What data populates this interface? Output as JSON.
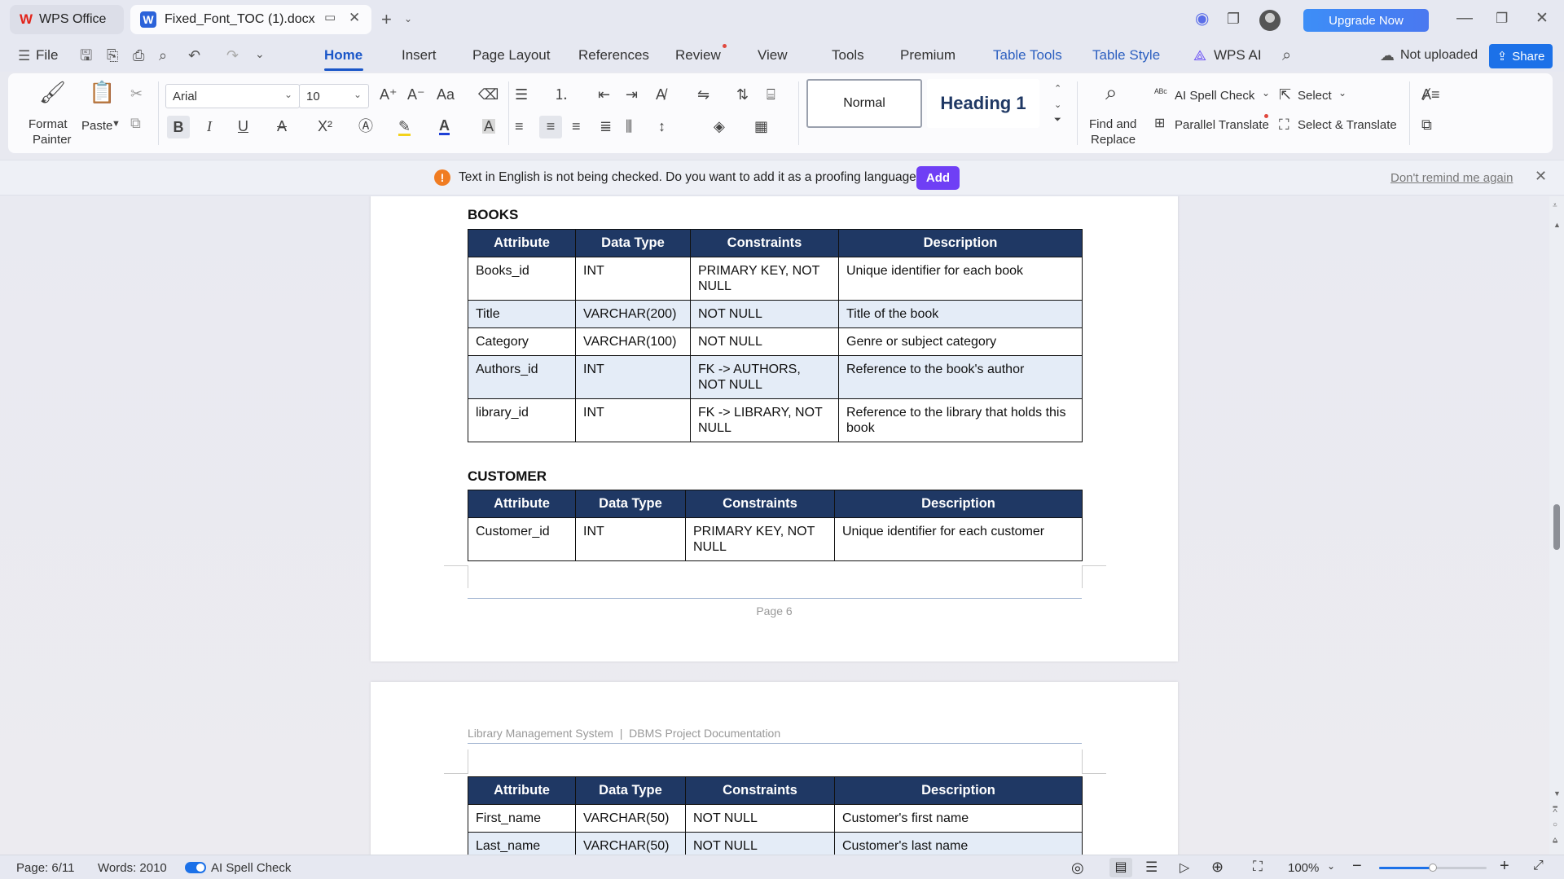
{
  "titlebar": {
    "app_tab": "WPS Office",
    "doc_tab": "Fixed_Font_TOC (1).docx",
    "upgrade": "Upgrade Now"
  },
  "menubar": {
    "file": "File",
    "items": [
      "Home",
      "Insert",
      "Page Layout",
      "References",
      "Review",
      "View",
      "Tools",
      "Premium",
      "Table Tools",
      "Table Style"
    ],
    "wps_ai": "WPS AI",
    "not_uploaded": "Not uploaded",
    "share": "Share"
  },
  "ribbon": {
    "format_painter": [
      "Format",
      "Painter"
    ],
    "paste": "Paste",
    "font_name": "Arial",
    "font_size": "10",
    "style_normal": "Normal",
    "style_heading": "Heading 1",
    "find_replace": [
      "Find and",
      "Replace"
    ],
    "ai_spell": "AI Spell Check",
    "parallel_translate": "Parallel Translate",
    "select": "Select",
    "select_translate": "Select & Translate"
  },
  "notification": {
    "message": "Text in English is not being checked. Do you want to add it as a proofing language?",
    "add": "Add",
    "dismiss": "Don't remind me again"
  },
  "document": {
    "books_heading": "BOOKS",
    "customer_heading": "CUSTOMER",
    "headers": [
      "Attribute",
      "Data Type",
      "Constraints",
      "Description"
    ],
    "books_rows": [
      [
        "Books_id",
        "INT",
        "PRIMARY KEY, NOT NULL",
        "Unique identifier for each book"
      ],
      [
        "Title",
        "VARCHAR(200)",
        "NOT NULL",
        "Title of the book"
      ],
      [
        "Category",
        "VARCHAR(100)",
        "NOT NULL",
        "Genre or subject category"
      ],
      [
        "Authors_id",
        "INT",
        "FK -> AUTHORS, NOT NULL",
        "Reference to the book's author"
      ],
      [
        "library_id",
        "INT",
        "FK -> LIBRARY, NOT NULL",
        "Reference to the library that holds this book"
      ]
    ],
    "customer_rows": [
      [
        "Customer_id",
        "INT",
        "PRIMARY KEY, NOT NULL",
        "Unique identifier for each customer"
      ]
    ],
    "page_footer": "Page 6",
    "page_header": "Library Management System  |  DBMS Project Documentation",
    "customer_rows_cont": [
      [
        "First_name",
        "VARCHAR(50)",
        "NOT NULL",
        "Customer's first name"
      ],
      [
        "Last_name",
        "VARCHAR(50)",
        "NOT NULL",
        "Customer's last name"
      ]
    ]
  },
  "statusbar": {
    "page": "Page: 6/11",
    "words": "Words: 2010",
    "spell": "AI Spell Check",
    "zoom": "100%"
  },
  "colors": {
    "accent": "#1a56c8",
    "table_header": "#1f3864",
    "row_tint": "#e4ecf7",
    "add_button": "#6f3ff5"
  }
}
